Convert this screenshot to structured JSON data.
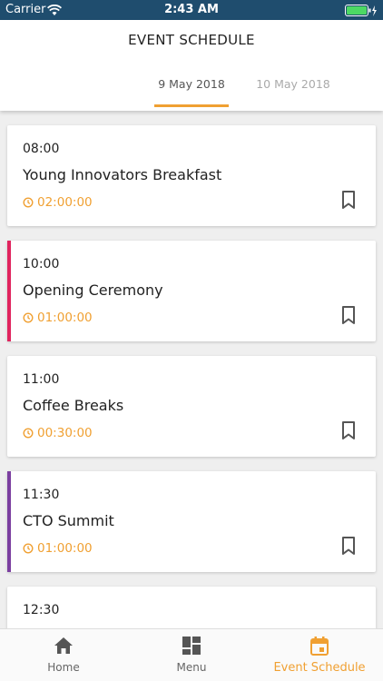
{
  "status_bar": {
    "carrier": "Carrier",
    "time": "2:43 AM"
  },
  "header": {
    "title": "EVENT SCHEDULE",
    "tabs": [
      {
        "label": "9 May 2018",
        "active": true
      },
      {
        "label": "10 May 2018",
        "active": false
      }
    ]
  },
  "events": [
    {
      "time": "08:00",
      "name": "Young Innovators Breakfast",
      "duration": "02:00:00",
      "accent": ""
    },
    {
      "time": "10:00",
      "name": "Opening Ceremony",
      "duration": "01:00:00",
      "accent": "#e0245e"
    },
    {
      "time": "11:00",
      "name": "Coffee Breaks",
      "duration": "00:30:00",
      "accent": ""
    },
    {
      "time": "11:30",
      "name": "CTO Summit",
      "duration": "01:00:00",
      "accent": "#7b3fa0"
    },
    {
      "time": "12:30",
      "name": "",
      "duration": "",
      "accent": ""
    }
  ],
  "bottom_nav": [
    {
      "label": "Home",
      "icon": "home-icon",
      "active": false
    },
    {
      "label": "Menu",
      "icon": "menu-grid-icon",
      "active": false
    },
    {
      "label": "Event Schedule",
      "icon": "calendar-icon",
      "active": true
    }
  ],
  "colors": {
    "accent": "#f0a032",
    "status_bar": "#1f4d6e"
  }
}
